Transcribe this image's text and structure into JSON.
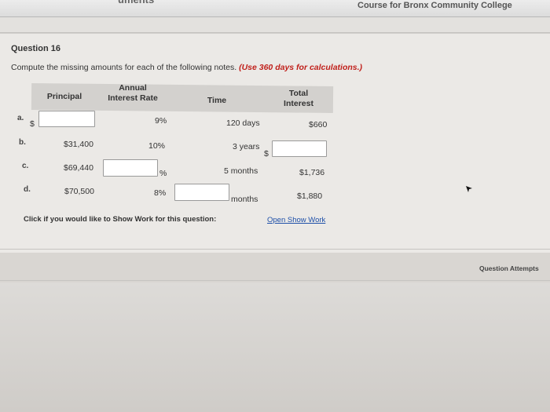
{
  "top_bar": {
    "left_fragment": "uments",
    "college": "Course for Bronx Community College"
  },
  "question": {
    "title": "Question 16",
    "prompt": "Compute the missing amounts for each of the following notes.",
    "hint": "(Use 360 days for calculations.)"
  },
  "table": {
    "headers": {
      "principal": "Principal",
      "rate_line1": "Annual",
      "rate_line2": "Interest Rate",
      "time": "Time",
      "interest_line1": "Total",
      "interest_line2": "Interest"
    },
    "rows": [
      {
        "label": "a.",
        "principal_prefix": "$",
        "principal": "",
        "rate": "9%",
        "time": "120 days",
        "interest": "$660"
      },
      {
        "label": "b.",
        "principal": "$31,400",
        "rate": "10%",
        "time": "3 years",
        "interest_prefix": "$",
        "interest": ""
      },
      {
        "label": "c.",
        "principal": "$69,440",
        "rate": "",
        "rate_suffix": "%",
        "time": "5 months",
        "interest": "$1,736"
      },
      {
        "label": "d.",
        "principal": "$70,500",
        "rate": "8%",
        "time": "",
        "time_suffix": "months",
        "interest": "$1,880"
      }
    ]
  },
  "show_work": {
    "label": "Click if you would like to Show Work for this question:",
    "link": "Open Show Work"
  },
  "attempts_label": "Question Attempts"
}
